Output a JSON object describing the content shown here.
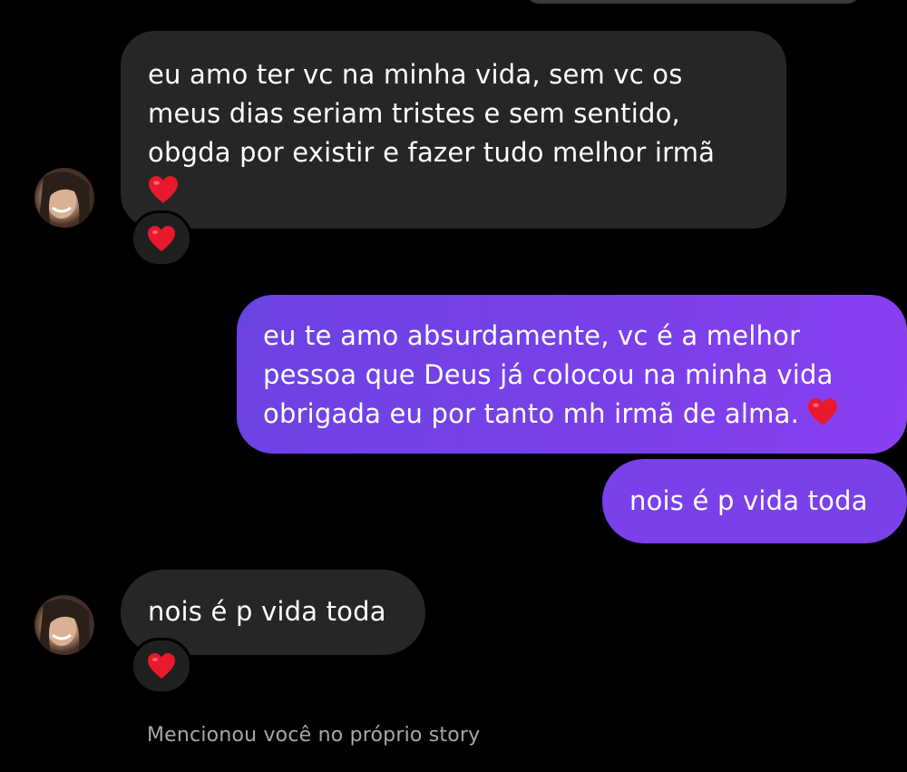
{
  "messages": [
    {
      "direction": "incoming",
      "lines": [
        "eu amo ter vc na minha vida, sem vc os",
        "meus dias seriam tristes e sem sentido,",
        "obgda por existir e fazer tudo melhor irmã"
      ],
      "trailing_emoji": "red-heart-icon",
      "reaction": "red-heart-icon"
    },
    {
      "direction": "outgoing",
      "lines": [
        "eu te amo absurdamente, vc é a melhor",
        "pessoa que Deus já colocou na minha vida",
        "obrigada eu por tanto mh irmã de alma. "
      ],
      "trailing_emoji": "red-heart-icon"
    },
    {
      "direction": "outgoing",
      "text": "nois é p vida toda"
    },
    {
      "direction": "incoming",
      "text": "nois é p vida toda",
      "reaction": "red-heart-icon"
    }
  ],
  "mention_notice": "Mencionou você no próprio story",
  "colors": {
    "background": "#000000",
    "incoming_bubble": "#262626",
    "outgoing_bubble": "#7a40ea",
    "heart": "#e8192c",
    "muted_text": "#a8a8a8"
  }
}
